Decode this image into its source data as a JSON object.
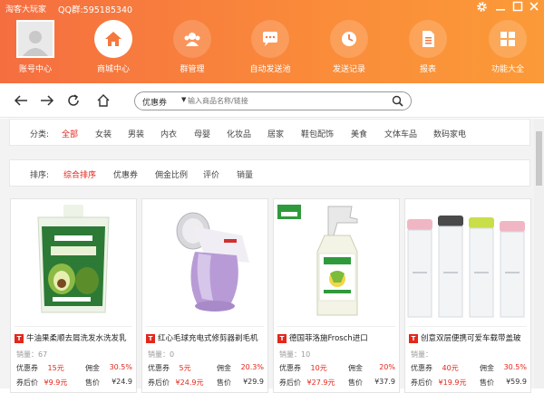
{
  "app": {
    "title": "淘客大玩家",
    "qq_group": "QQ群:595185340"
  },
  "window_controls": [
    "gear-icon",
    "minimize-icon",
    "maximize-icon",
    "close-icon"
  ],
  "nav": [
    {
      "label": "账号中心",
      "icon": "avatar"
    },
    {
      "label": "商城中心",
      "icon": "home-icon",
      "active": true
    },
    {
      "label": "群管理",
      "icon": "group-icon"
    },
    {
      "label": "自动发送池",
      "icon": "chat-icon"
    },
    {
      "label": "发送记录",
      "icon": "clock-icon"
    },
    {
      "label": "报表",
      "icon": "report-icon"
    },
    {
      "label": "功能大全",
      "icon": "grid-icon"
    }
  ],
  "search": {
    "selected": "优惠券",
    "placeholder": "输入商品名称/链接"
  },
  "category": {
    "label": "分类:",
    "items": [
      "全部",
      "女装",
      "男装",
      "内衣",
      "母婴",
      "化妆品",
      "居家",
      "鞋包配饰",
      "美食",
      "文体车品",
      "数码家电"
    ],
    "active": "全部"
  },
  "sort": {
    "label": "排序:",
    "items": [
      "综合排序",
      "优惠券",
      "佣金比例",
      "评价",
      "销量"
    ],
    "active": "综合排序"
  },
  "products": [
    {
      "title": "牛油果柔顺去屑洗发水洗发乳",
      "sales": "销量：67",
      "coupon_label": "优惠券",
      "coupon": "15元",
      "commission_label": "佣金",
      "commission": "30.5%",
      "after_label": "券后价",
      "after_price": "¥9.9元",
      "price_label": "售价",
      "price": "¥24.9"
    },
    {
      "title": "红心毛球充电式修剪器剃毛机",
      "sales": "销量：0",
      "coupon_label": "优惠券",
      "coupon": "5元",
      "commission_label": "佣金",
      "commission": "20.3%",
      "after_label": "券后价",
      "after_price": "¥24.9元",
      "price_label": "售价",
      "price": "¥29.9"
    },
    {
      "title": "德国菲洛施Frosch进口",
      "sales": "销量：10",
      "coupon_label": "优惠券",
      "coupon": "10元",
      "commission_label": "佣金",
      "commission": "20%",
      "after_label": "券后价",
      "after_price": "¥27.9元",
      "price_label": "售价",
      "price": "¥37.9"
    },
    {
      "title": "创意双层便携可爱车载带盖玻",
      "sales": "销量：",
      "coupon_label": "优惠券",
      "coupon": "40元",
      "commission_label": "佣金",
      "commission": "30.5%",
      "after_label": "券后价",
      "after_price": "¥19.9元",
      "price_label": "售价",
      "price": "¥59.9"
    }
  ],
  "colors": {
    "accent": "#f6783e",
    "highlight": "#e4271b"
  }
}
